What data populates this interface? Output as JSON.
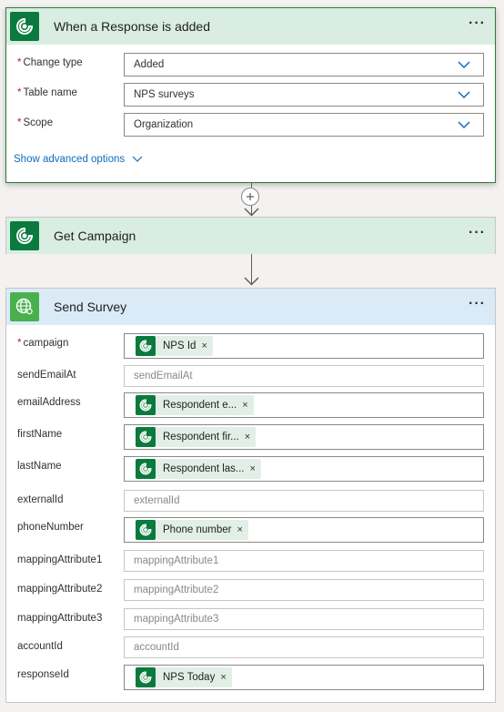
{
  "trigger": {
    "title": "When a Response is added",
    "menu": "···",
    "fields": [
      {
        "label": "Change type",
        "value": "Added",
        "required": "*"
      },
      {
        "label": "Table name",
        "value": "NPS surveys",
        "required": "*"
      },
      {
        "label": "Scope",
        "value": "Organization",
        "required": "*"
      }
    ],
    "advanced_label": "Show advanced options"
  },
  "get_campaign": {
    "title": "Get Campaign",
    "menu": "···"
  },
  "send_survey": {
    "title": "Send Survey",
    "menu": "···",
    "fields": [
      {
        "label": "campaign",
        "required": "*",
        "token": "NPS Id"
      },
      {
        "label": "sendEmailAt",
        "placeholder": "sendEmailAt"
      },
      {
        "label": "emailAddress",
        "token": "Respondent e..."
      },
      {
        "label": "firstName",
        "token": "Respondent fir..."
      },
      {
        "label": "lastName",
        "token": "Respondent las..."
      },
      {
        "label": "externalId",
        "placeholder": "externalId"
      },
      {
        "label": "phoneNumber",
        "token": "Phone number"
      },
      {
        "label": "mappingAttribute1",
        "placeholder": "mappingAttribute1"
      },
      {
        "label": "mappingAttribute2",
        "placeholder": "mappingAttribute2"
      },
      {
        "label": "mappingAttribute3",
        "placeholder": "mappingAttribute3"
      },
      {
        "label": "accountId",
        "placeholder": "accountId"
      },
      {
        "label": "responseId",
        "token": "NPS Today"
      }
    ]
  },
  "token_remove": "×",
  "colors": {
    "dataverse": "#0b7a3e",
    "http": "#49b04d",
    "link": "#0f6cbd",
    "required": "#a4262c"
  }
}
